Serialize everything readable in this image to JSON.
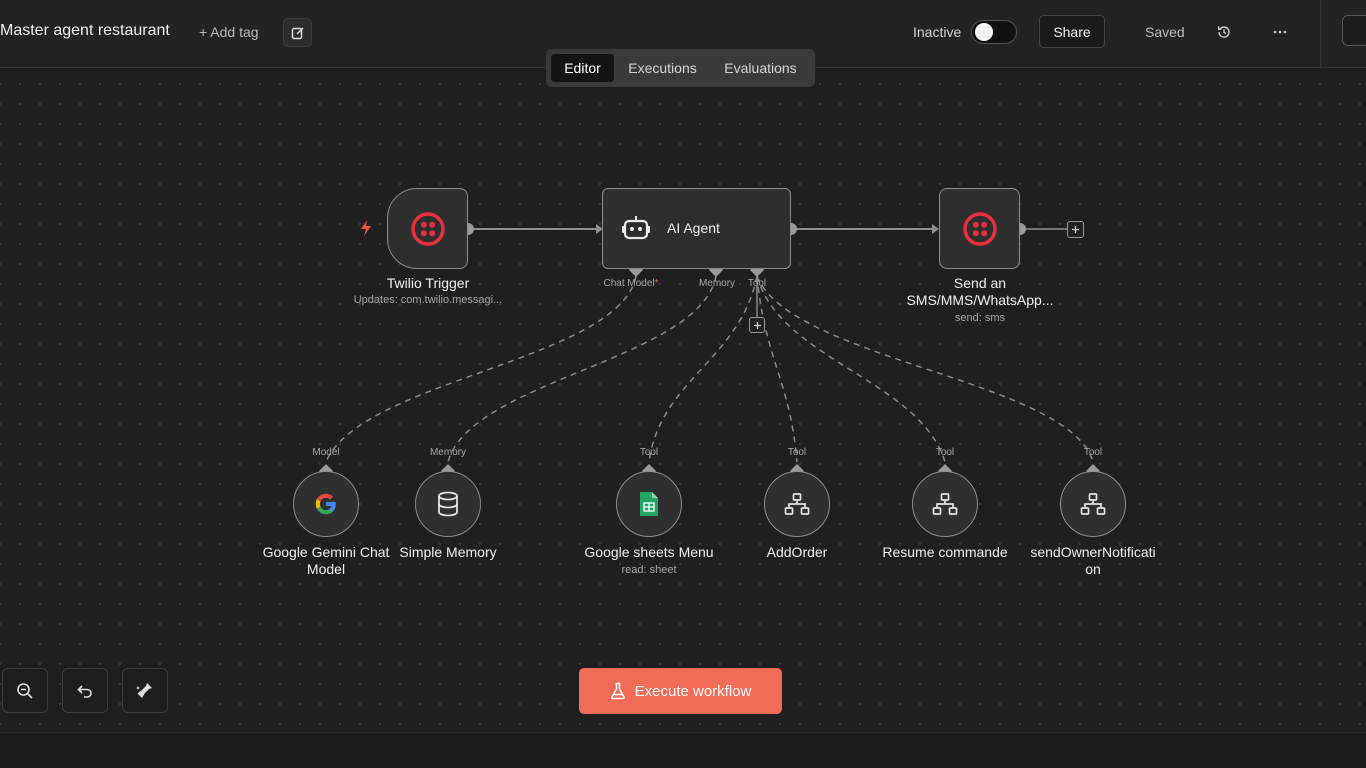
{
  "header": {
    "workflow_name": "Master agent restaurant",
    "add_tag": "+ Add tag",
    "status_label": "Inactive",
    "share_label": "Share",
    "saved_label": "Saved"
  },
  "tabs": [
    {
      "label": "Editor",
      "active": true
    },
    {
      "label": "Executions",
      "active": false
    },
    {
      "label": "Evaluations",
      "active": false
    }
  ],
  "nodes": {
    "twilio_trigger": {
      "title": "Twilio Trigger",
      "subtitle": "Updates: com.twilio.messagi...",
      "icon": "twilio-icon"
    },
    "ai_agent": {
      "title": "AI Agent",
      "icon": "robot-icon",
      "handles": {
        "chat_model": "Chat Model",
        "memory": "Memory",
        "tool": "Tool"
      }
    },
    "send_sms": {
      "title_line1": "Send an",
      "title_line2": "SMS/MMS/WhatsApp...",
      "subtitle": "send: sms",
      "icon": "twilio-icon"
    },
    "gemini": {
      "handle": "Model",
      "title_line1": "Google Gemini Chat",
      "title_line2": "Model",
      "icon": "google-icon"
    },
    "memory": {
      "handle": "Memory",
      "title": "Simple Memory",
      "icon": "database-icon"
    },
    "sheets": {
      "handle": "Tool",
      "title": "Google sheets Menu",
      "subtitle": "read: sheet",
      "icon": "google-sheets-icon"
    },
    "add_order": {
      "handle": "Tool",
      "title": "AddOrder",
      "icon": "sitemap-icon"
    },
    "resume": {
      "handle": "Tool",
      "title": "Resume commande",
      "icon": "sitemap-icon"
    },
    "notify": {
      "handle": "Tool",
      "title_line1": "sendOwnerNotificati",
      "title_line2": "on",
      "icon": "sitemap-icon"
    }
  },
  "controls": {
    "execute_label": "Execute workflow"
  },
  "colors": {
    "accent": "#f26b56",
    "twilio": "#e8303f",
    "trigger_bolt": "#f0553f",
    "sheets_green": "#23a566"
  }
}
